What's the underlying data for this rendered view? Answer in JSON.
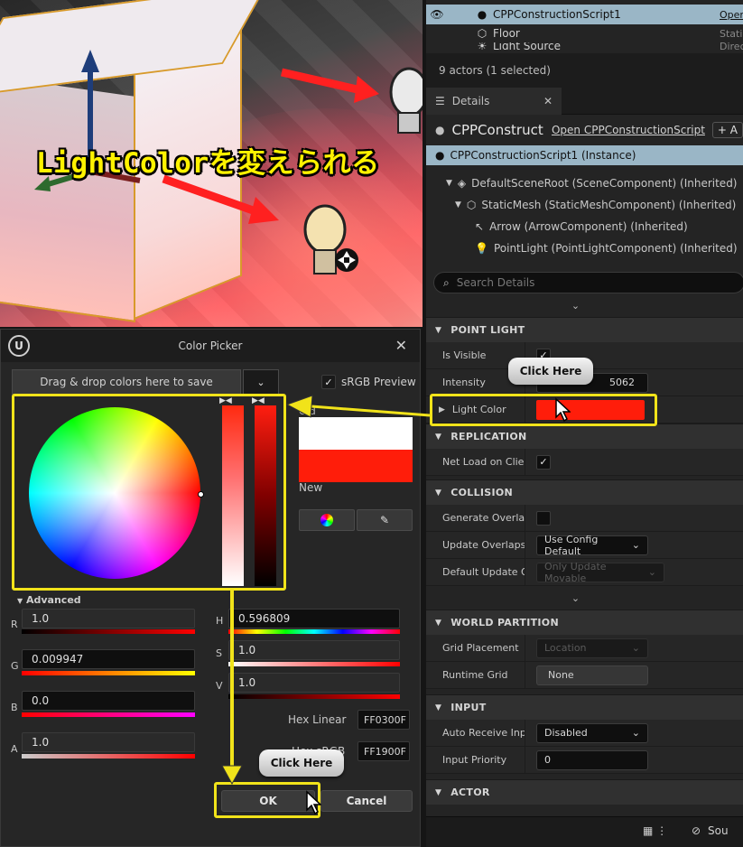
{
  "viewport": {
    "banner_text": "LightColorを変えられる"
  },
  "outliner": {
    "rows": [
      {
        "label": "CPPConstructionScript1",
        "type": "Open",
        "selected": true
      },
      {
        "label": "Floor",
        "type": "Stati",
        "selected": false
      },
      {
        "label": "Light Source",
        "type": "Direc",
        "selected": false
      }
    ],
    "actor_count": "9 actors (1 selected)"
  },
  "details": {
    "tab_label": "Details",
    "actor_name": "CPPConstructio",
    "open_link": "Open CPPConstructionScript",
    "add_label": "+ A",
    "components": [
      {
        "label": "CPPConstructionScript1 (Instance)",
        "icon": "actor-icon"
      },
      {
        "label": "DefaultSceneRoot (SceneComponent) (Inherited)",
        "icon": "scene-root-icon"
      },
      {
        "label": "StaticMesh (StaticMeshComponent) (Inherited)",
        "icon": "mesh-icon"
      },
      {
        "label": "Arrow (ArrowComponent) (Inherited)",
        "icon": "arrow-icon"
      },
      {
        "label": "PointLight (PointLightComponent) (Inherited)",
        "icon": "light-icon"
      }
    ],
    "search_placeholder": "Search Details",
    "sections": {
      "point_light": {
        "title": "POINT LIGHT",
        "is_visible": "Is Visible",
        "intensity": "Intensity",
        "intensity_value": "5062",
        "light_color": "Light Color",
        "light_color_hex": "#ff1d0a"
      },
      "replication": {
        "title": "REPLICATION",
        "net_load": "Net Load on Client"
      },
      "collision": {
        "title": "COLLISION",
        "generate_overlap": "Generate Overlap",
        "update_overlaps": "Update Overlaps M",
        "update_overlaps_value": "Use Config Default",
        "default_update": "Default Update Ov",
        "default_update_value": "Only Update Movable"
      },
      "world_partition": {
        "title": "WORLD PARTITION",
        "grid_placement": "Grid Placement",
        "grid_placement_value": "Location",
        "runtime_grid": "Runtime Grid",
        "runtime_grid_value": "None"
      },
      "input": {
        "title": "INPUT",
        "auto_receive": "Auto Receive Inpu",
        "auto_receive_value": "Disabled",
        "input_priority": "Input Priority",
        "input_priority_value": "0"
      },
      "actor": {
        "title": "ACTOR"
      }
    },
    "status_source": "Sou"
  },
  "picker": {
    "title": "Color Picker",
    "drag_drop": "Drag & drop colors here to save",
    "srgb_label": "sRGB Preview",
    "old_label": "Old",
    "new_label": "New",
    "advanced_label": "Advanced",
    "channels": {
      "r": {
        "label": "R",
        "value": "1.0"
      },
      "g": {
        "label": "G",
        "value": "0.009947"
      },
      "b": {
        "label": "B",
        "value": "0.0"
      },
      "a": {
        "label": "A",
        "value": "1.0"
      },
      "h": {
        "label": "H",
        "value": "0.596809"
      },
      "s": {
        "label": "S",
        "value": "1.0"
      },
      "v": {
        "label": "V",
        "value": "1.0"
      }
    },
    "hex_linear_label": "Hex Linear",
    "hex_linear_value": "FF0300F",
    "hex_srgb_label": "Hex sRGB",
    "hex_srgb_value": "FF1900F",
    "ok_label": "OK",
    "cancel_label": "Cancel",
    "new_color": "#ff1d0a"
  },
  "annotations": {
    "callout_top": "Click Here",
    "callout_bottom": "Click Here",
    "frame_color": "#f1e31a"
  }
}
